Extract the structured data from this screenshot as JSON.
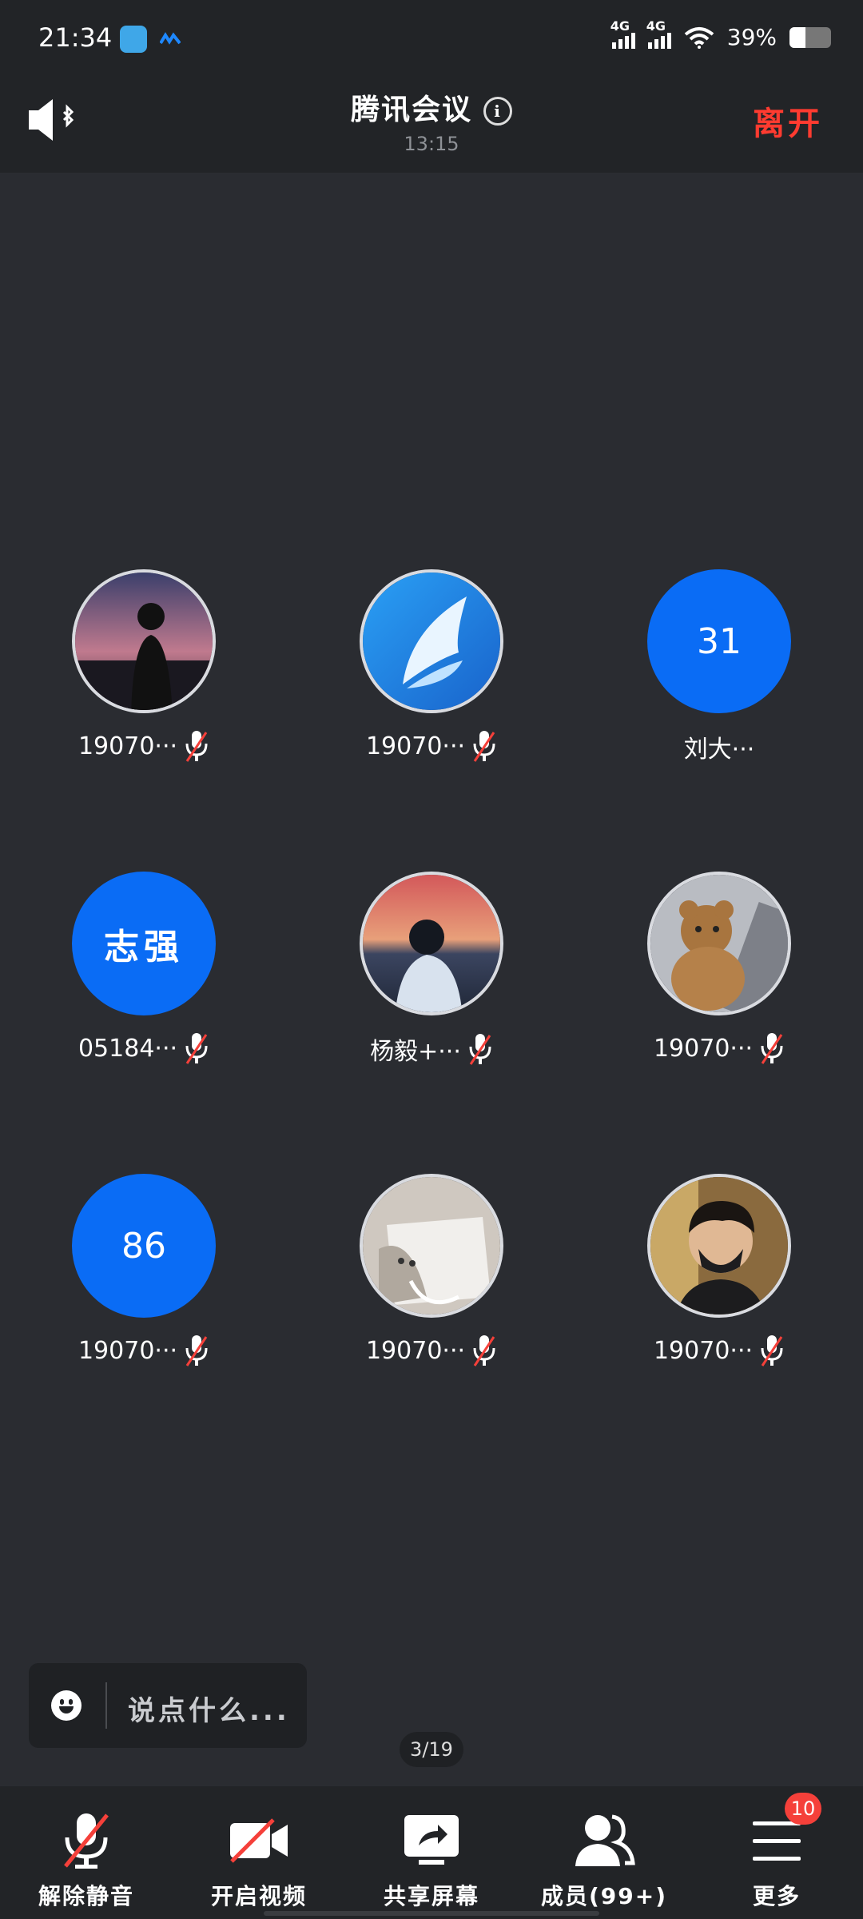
{
  "status_bar": {
    "time": "21:34",
    "network1": "4G",
    "network2": "4G",
    "battery": "39%",
    "battery_level": 0.39
  },
  "header": {
    "title": "腾讯会议",
    "duration": "13:15",
    "leave_label": "离开"
  },
  "participants": [
    {
      "name": "19070···",
      "avatar_type": "photo",
      "avatar_text": "",
      "muted": true
    },
    {
      "name": "19070···",
      "avatar_type": "photo",
      "avatar_text": "",
      "muted": true
    },
    {
      "name": "刘大···",
      "avatar_type": "initials",
      "avatar_text": "31",
      "muted": false
    },
    {
      "name": "05184···",
      "avatar_type": "initials",
      "avatar_text": "志强",
      "muted": true
    },
    {
      "name": "杨毅+···",
      "avatar_type": "photo",
      "avatar_text": "",
      "muted": true
    },
    {
      "name": "19070···",
      "avatar_type": "photo",
      "avatar_text": "",
      "muted": true
    },
    {
      "name": "19070···",
      "avatar_type": "initials",
      "avatar_text": "86",
      "muted": true
    },
    {
      "name": "19070···",
      "avatar_type": "photo",
      "avatar_text": "",
      "muted": true
    },
    {
      "name": "19070···",
      "avatar_type": "photo",
      "avatar_text": "",
      "muted": true
    }
  ],
  "chat": {
    "placeholder": "说点什么..."
  },
  "page_indicator": "3/19",
  "toolbar": {
    "unmute_label": "解除静音",
    "video_label": "开启视频",
    "share_label": "共享屏幕",
    "members_label": "成员(99+)",
    "more_label": "更多",
    "more_badge": "10"
  },
  "colors": {
    "accent_blue": "#0a6cf5",
    "leave_red": "#ff3b30",
    "badge_red": "#f5403a",
    "background": "#2a2c31"
  }
}
